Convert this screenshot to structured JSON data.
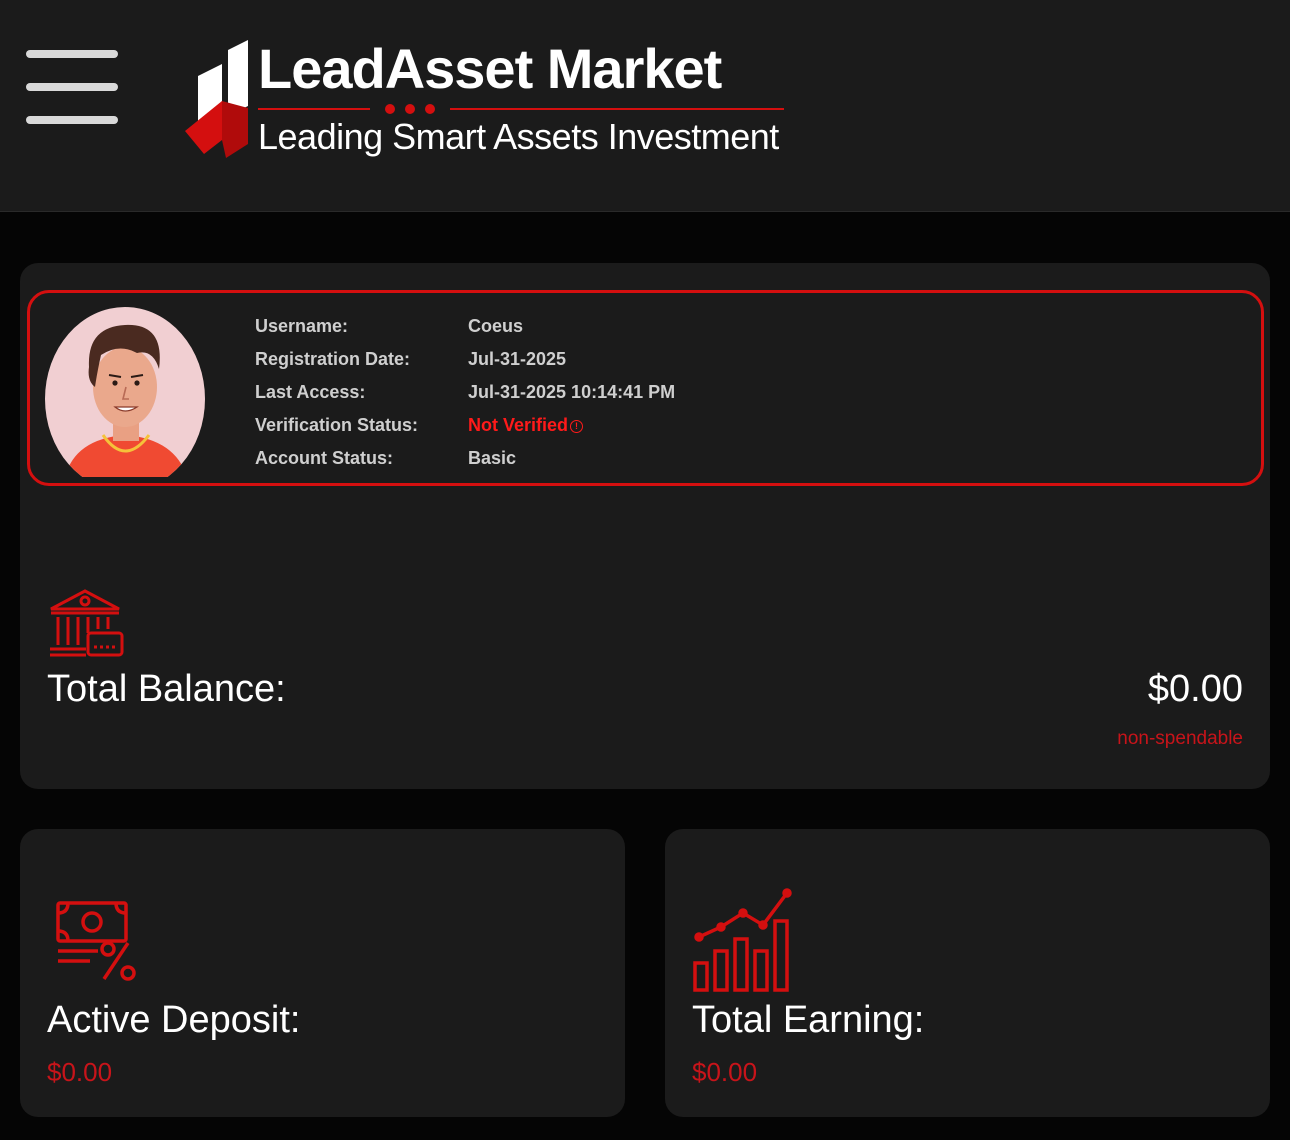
{
  "header": {
    "brand_name": "LeadAsset Market",
    "tagline": "Leading Smart Assets Investment",
    "menu_icon": "hamburger-menu-icon"
  },
  "profile": {
    "rows": [
      {
        "label": "Username:",
        "value": "Coeus"
      },
      {
        "label": "Registration Date:",
        "value": "Jul-31-2025"
      },
      {
        "label": "Last Access:",
        "value": "Jul-31-2025 10:14:41 PM"
      },
      {
        "label": "Verification Status:",
        "value": "Not Verified"
      },
      {
        "label": "Account Status:",
        "value": "Basic"
      }
    ],
    "avatar_icon": "user-avatar-icon",
    "warning_icon": "info-circle-icon"
  },
  "balance": {
    "label": "Total Balance:",
    "value": "$0.00",
    "note": "non-spendable",
    "icon": "bank-card-icon"
  },
  "active_deposit": {
    "label": "Active Deposit:",
    "value": "$0.00",
    "icon": "cash-percent-icon"
  },
  "total_earning": {
    "label": "Total Earning:",
    "value": "$0.00",
    "icon": "growth-chart-icon"
  },
  "colors": {
    "accent": "#d40f0f",
    "background": "#050505",
    "card": "#1b1b1b"
  }
}
